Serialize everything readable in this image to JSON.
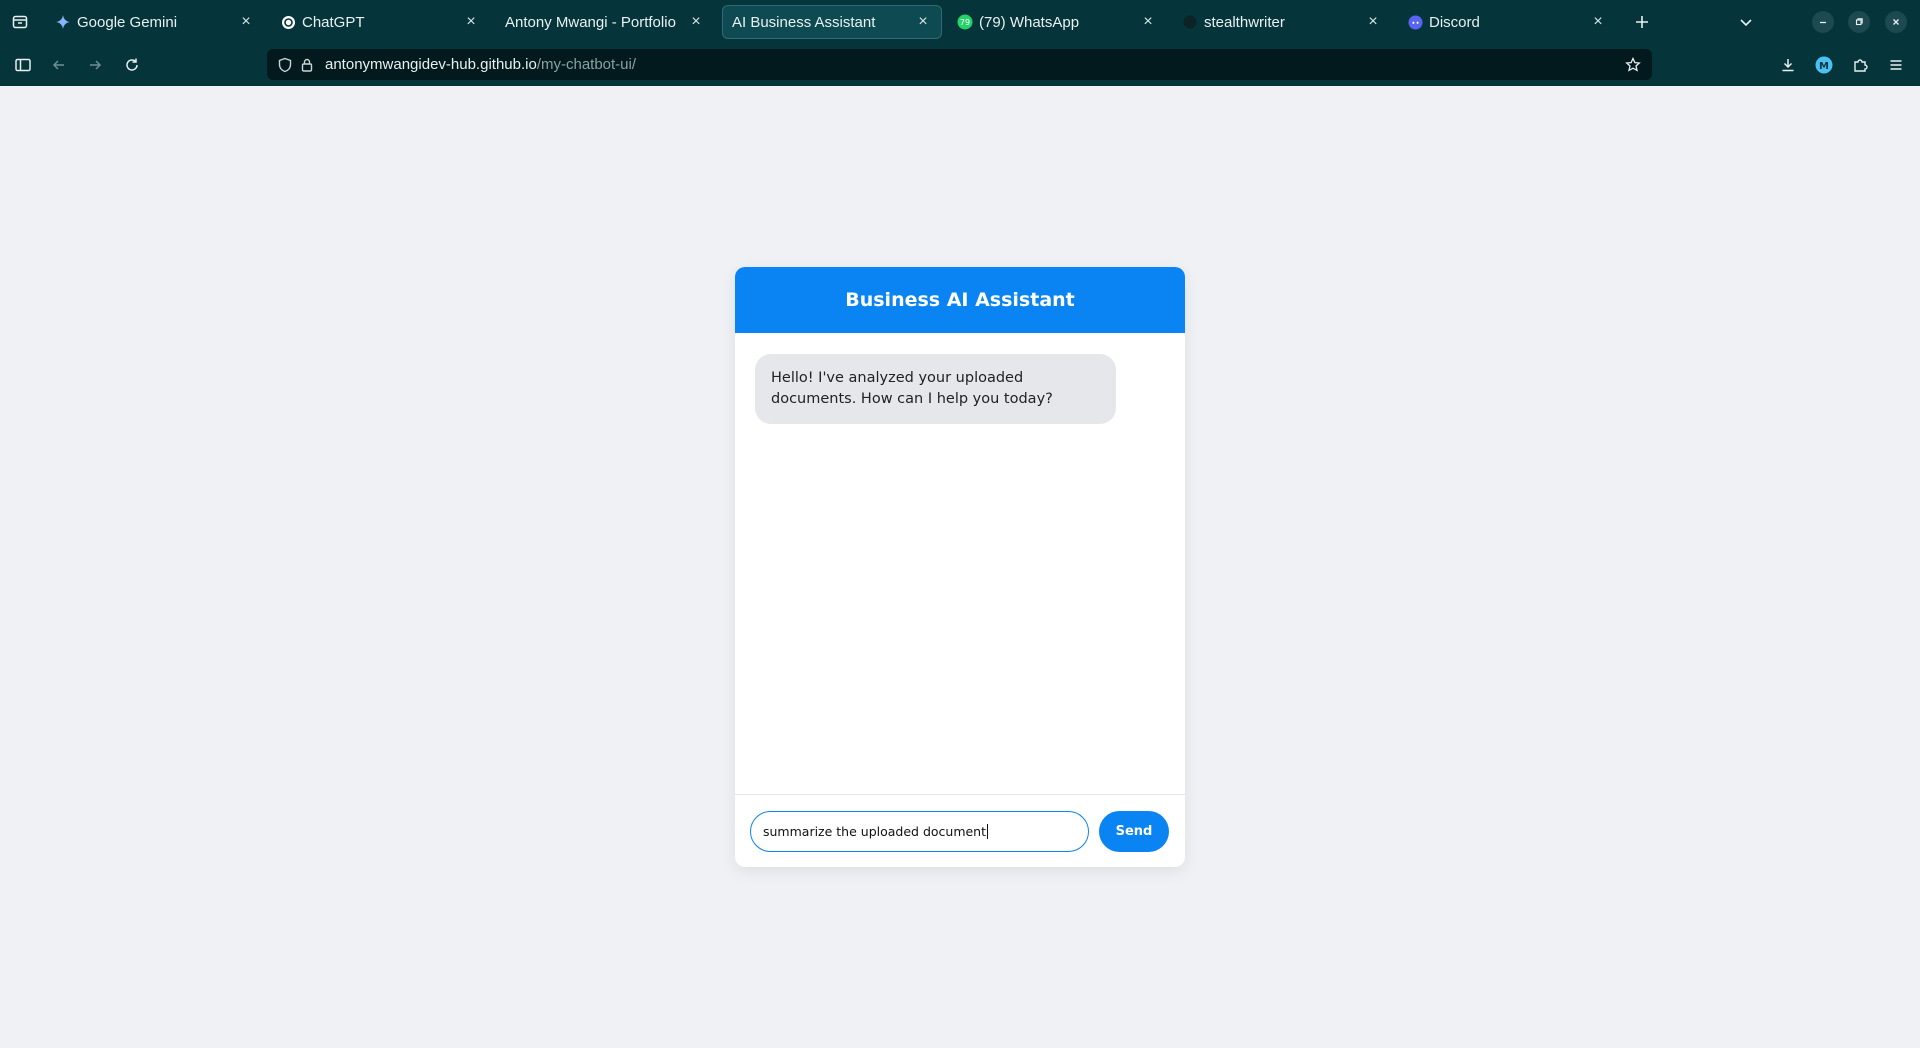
{
  "browser": {
    "tabs": [
      {
        "title": "Google Gemini",
        "icon": "gemini-icon"
      },
      {
        "title": "ChatGPT",
        "icon": "chatgpt-icon"
      },
      {
        "title": "Antony Mwangi - Portfolio",
        "icon": ""
      },
      {
        "title": "AI Business Assistant",
        "icon": "",
        "active": true
      },
      {
        "title": "(79) WhatsApp",
        "icon": "whatsapp-icon",
        "badge": "79"
      },
      {
        "title": "stealthwriter",
        "icon": "stealthwriter-icon"
      },
      {
        "title": "Discord",
        "icon": "discord-icon"
      }
    ],
    "url": {
      "host": "antonymwangidev-hub.github.io",
      "path": "/my-chatbot-ui/"
    },
    "profile_initial": "M"
  },
  "chat": {
    "header_title": "Business AI Assistant",
    "messages": [
      {
        "sender": "bot",
        "text": "Hello! I've analyzed your uploaded documents. How can I help you today?"
      }
    ],
    "input_value": "summarize the uploaded document",
    "send_label": "Send"
  },
  "colors": {
    "accent": "#0a84f2",
    "chrome": "#05353a",
    "page_bg": "#eff1f5",
    "bubble_bg": "#e5e7eb"
  }
}
